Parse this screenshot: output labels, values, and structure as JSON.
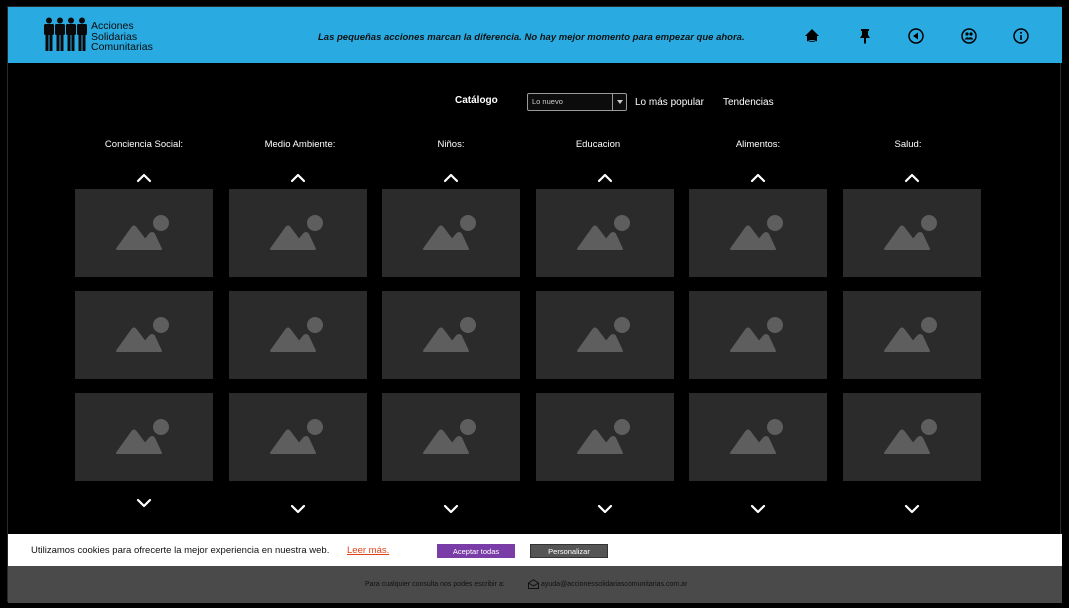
{
  "brand": {
    "name_lines": [
      "Acciones",
      "Solidarias",
      "Comunitarias"
    ],
    "tagline": "Las pequeñas acciones marcan la diferencia. No hay mejor momento para empezar que ahora."
  },
  "nav_icons": [
    "home-icon",
    "pin-icon",
    "back-icon",
    "community-icon",
    "info-icon"
  ],
  "filters": {
    "catalog_label": "Catálogo",
    "select_value": "Lo nuevo",
    "popular_label": "Lo más popular",
    "trends_label": "Tendencias"
  },
  "categories": [
    {
      "label": "Conciencia Social:"
    },
    {
      "label": "Medio Ambiente:"
    },
    {
      "label": "Niños:"
    },
    {
      "label": "Educacion"
    },
    {
      "label": "Alimentos:"
    },
    {
      "label": "Salud:"
    }
  ],
  "tiles_per_category": 3,
  "cookie": {
    "text": "Utilizamos cookies para ofrecerte la mejor experiencia en nuestra web.",
    "link": "Leer más.",
    "accept_label": "Aceptar todas",
    "customize_label": "Personalizar"
  },
  "footer": {
    "text": "Para cualquier consulta nos podes escribir a:",
    "email": "ayuda@accionessolidariascomunitarias.com.ar"
  },
  "colors": {
    "header": "#29abe2",
    "tile": "#2b2b2b",
    "accept_button": "#7a3ca6",
    "cookie_link": "#e0421a",
    "footer": "#4a4a4a"
  }
}
